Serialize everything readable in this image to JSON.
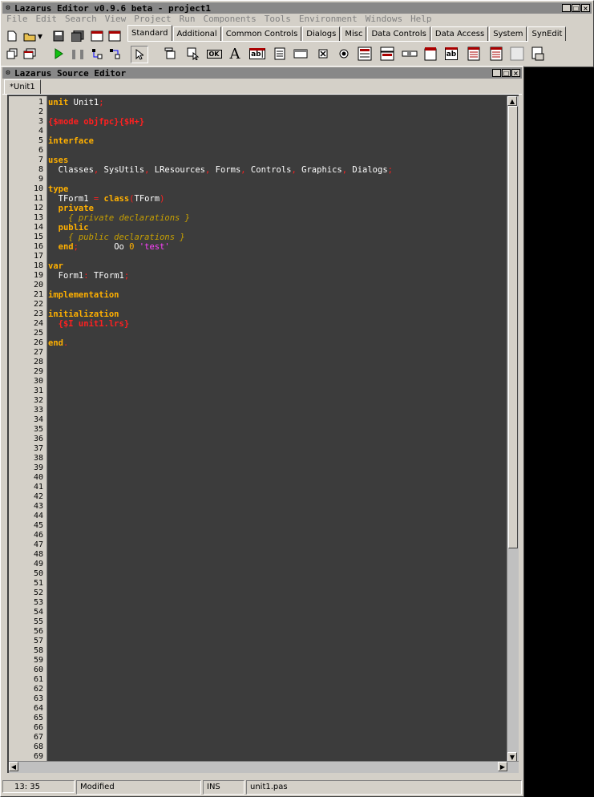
{
  "main_window": {
    "title": "Lazarus Editor v0.9.6 beta - project1",
    "menu": [
      "File",
      "Edit",
      "Search",
      "View",
      "Project",
      "Run",
      "Components",
      "Tools",
      "Environment",
      "Windows",
      "Help"
    ]
  },
  "palette": {
    "tabs": [
      "Standard",
      "Additional",
      "Common Controls",
      "Dialogs",
      "Misc",
      "Data Controls",
      "Data Access",
      "System",
      "SynEdit"
    ],
    "active_tab": "Standard",
    "button_ok_label": "OK",
    "label_glyph": "A",
    "edit_glyph": "ab|",
    "memo_glyph": "ab"
  },
  "source_editor": {
    "title": "Lazarus Source Editor",
    "tab_label": "*Unit1",
    "line_numbers": [
      "1",
      "2",
      "3",
      "4",
      "5",
      "6",
      "7",
      "8",
      "9",
      "10",
      "11",
      "12",
      "13",
      "14",
      "15",
      "16",
      "17",
      "18",
      "19",
      "20",
      "21",
      "22",
      "23",
      "24",
      "25",
      "26",
      "27",
      "28",
      "29",
      "30",
      "31",
      "32",
      "33",
      "34",
      "35",
      "36",
      "37",
      "38",
      "39",
      "40",
      "41",
      "42",
      "43",
      "44",
      "45",
      "46",
      "47",
      "48",
      "49",
      "50",
      "51",
      "52",
      "53",
      "54",
      "55",
      "56",
      "57",
      "58",
      "59",
      "60",
      "61",
      "62",
      "63",
      "64",
      "65",
      "66",
      "67",
      "68",
      "69"
    ],
    "code": {
      "l1_kw": "unit",
      "l1_id": " Unit1",
      "l1_sym": ";",
      "l3_dir": "{$mode objfpc}{$H+}",
      "l5_kw": "interface",
      "l7_kw": "uses",
      "l8_a": "  Classes",
      "l8_b": " SysUtils",
      "l8_c": " LResources",
      "l8_d": " Forms",
      "l8_e": " Controls",
      "l8_f": " Graphics",
      "l8_g": " Dialogs",
      "comma": ",",
      "semi": ";",
      "l10_kw": "type",
      "l11_id": "  TForm1 ",
      "l11_eq": "=",
      "l11_kw": " class",
      "l11_op": "(",
      "l11_base": "TForm",
      "l11_cp": ")",
      "l12_kw": "  private",
      "l13_cm": "    { private declarations }",
      "l14_kw": "  public",
      "l15_cm": "    { public declarations }",
      "l16_kw": "  end",
      "l16_id": "       Oo ",
      "l16_num": "0",
      "l16_str": " 'test'",
      "l18_kw": "var",
      "l19_id": "  Form1",
      "l19_colon": ":",
      "l19_type": " TForm1",
      "l21_kw": "implementation",
      "l23_kw": "initialization",
      "l24_dir": "  {$I unit1.lrs}",
      "l26_kw": "end",
      "l26_dot": "."
    },
    "status": {
      "position": "13: 35",
      "modified": "Modified",
      "mode": "INS",
      "file": "unit1.pas"
    }
  },
  "colors": {
    "editor_bg": "#3c3c3c",
    "keyword": "#ffb000",
    "directive": "#ff2020",
    "comment": "#c8a000",
    "string": "#ff40ff"
  }
}
